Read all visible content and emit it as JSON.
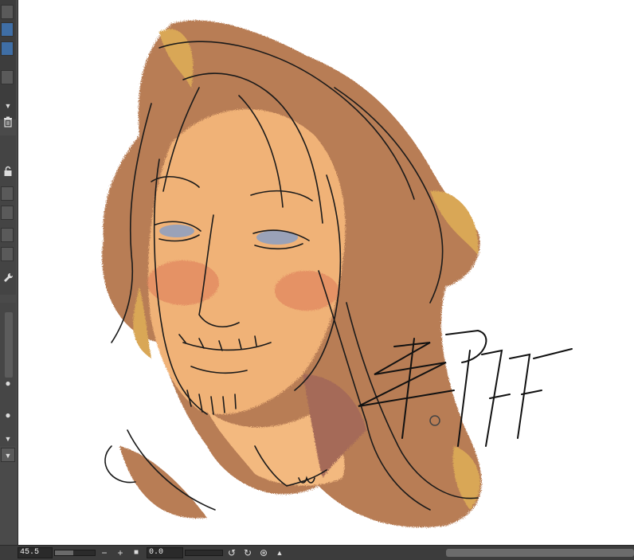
{
  "status_bar": {
    "zoom": "45.5",
    "rotation": "0.0",
    "zoom_level_percent": 45.5,
    "zoom_out_icon": "minus-icon",
    "zoom_in_icon": "plus-icon",
    "fit_icon": "stop-square-icon",
    "rotate_left_icon": "rotate-left-icon",
    "rotate_right_icon": "rotate-right-icon",
    "reset_rotation_icon": "reset-icon",
    "flip_icon": "flip-icon"
  },
  "left_panel": {
    "delete_icon": "trash-icon",
    "lock_icon": "lock-icon",
    "settings_icon": "wrench-icon",
    "dropdown_icon": "chevron-down-icon"
  },
  "colors": {
    "hair_base": "#b87d54",
    "hair_highlight": "#d9a757",
    "skin": "#f0b277",
    "cheek": "#e2875f",
    "neck_shadow": "#a56a58",
    "eye": "#9aa2b8",
    "ink": "#1a1a1a",
    "panel": "#4a4a4a"
  }
}
